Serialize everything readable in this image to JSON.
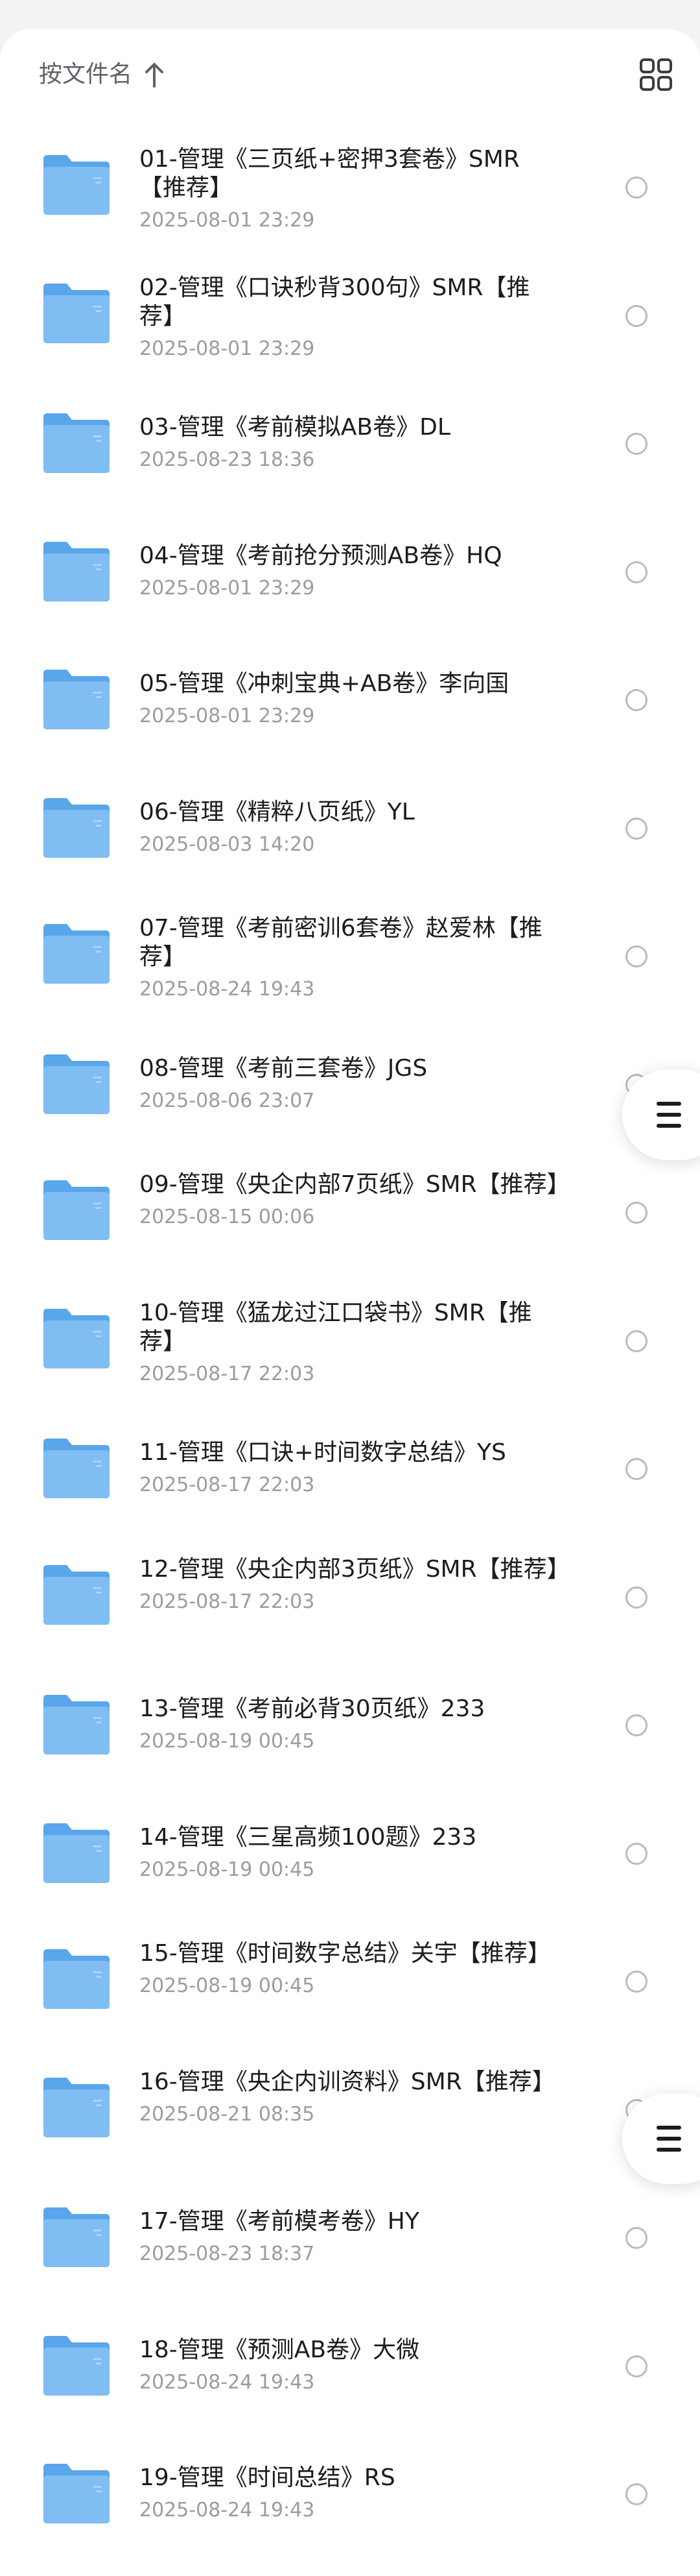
{
  "header": {
    "sort_label": "按文件名",
    "sort_icon": "arrow-up-icon",
    "view_icon": "grid-view-icon"
  },
  "colors": {
    "folder_front": "#7fbdf2",
    "folder_back": "#5aa6ea",
    "radio_border": "#b9bbbf"
  },
  "files": [
    {
      "name": "01-管理《三页纸+密押3套卷》SMR【推荐】",
      "date": "2025-08-01 23:29"
    },
    {
      "name": "02-管理《口诀秒背300句》SMR【推荐】",
      "date": "2025-08-01 23:29"
    },
    {
      "name": "03-管理《考前模拟AB卷》DL",
      "date": "2025-08-23 18:36"
    },
    {
      "name": "04-管理《考前抢分预测AB卷》HQ",
      "date": "2025-08-01 23:29"
    },
    {
      "name": "05-管理《冲刺宝典+AB卷》李向国",
      "date": "2025-08-01 23:29"
    },
    {
      "name": "06-管理《精粹八页纸》YL",
      "date": "2025-08-03 14:20"
    },
    {
      "name": "07-管理《考前密训6套卷》赵爱林【推荐】",
      "date": "2025-08-24 19:43"
    },
    {
      "name": "08-管理《考前三套卷》JGS",
      "date": "2025-08-06 23:07"
    },
    {
      "name": "09-管理《央企内部7页纸》SMR【推荐】",
      "date": "2025-08-15 00:06"
    },
    {
      "name": "10-管理《猛龙过江口袋书》SMR【推荐】",
      "date": "2025-08-17 22:03"
    },
    {
      "name": "11-管理《口诀+时间数字总结》YS",
      "date": "2025-08-17 22:03"
    },
    {
      "name": "12-管理《央企内部3页纸》SMR【推荐】",
      "date": "2025-08-17 22:03"
    },
    {
      "name": "13-管理《考前必背30页纸》233",
      "date": "2025-08-19 00:45"
    },
    {
      "name": "14-管理《三星高频100题》233",
      "date": "2025-08-19 00:45"
    },
    {
      "name": "15-管理《时间数字总结》关宇【推荐】",
      "date": "2025-08-19 00:45"
    },
    {
      "name": "16-管理《央企内训资料》SMR【推荐】",
      "date": "2025-08-21 08:35"
    },
    {
      "name": "17-管理《考前模考卷》HY",
      "date": "2025-08-23 18:37"
    },
    {
      "name": "18-管理《预测AB卷》大微",
      "date": "2025-08-24 19:43"
    },
    {
      "name": "19-管理《时间总结》RS",
      "date": "2025-08-24 19:43"
    }
  ],
  "floating_menu_icon": "menu-icon"
}
